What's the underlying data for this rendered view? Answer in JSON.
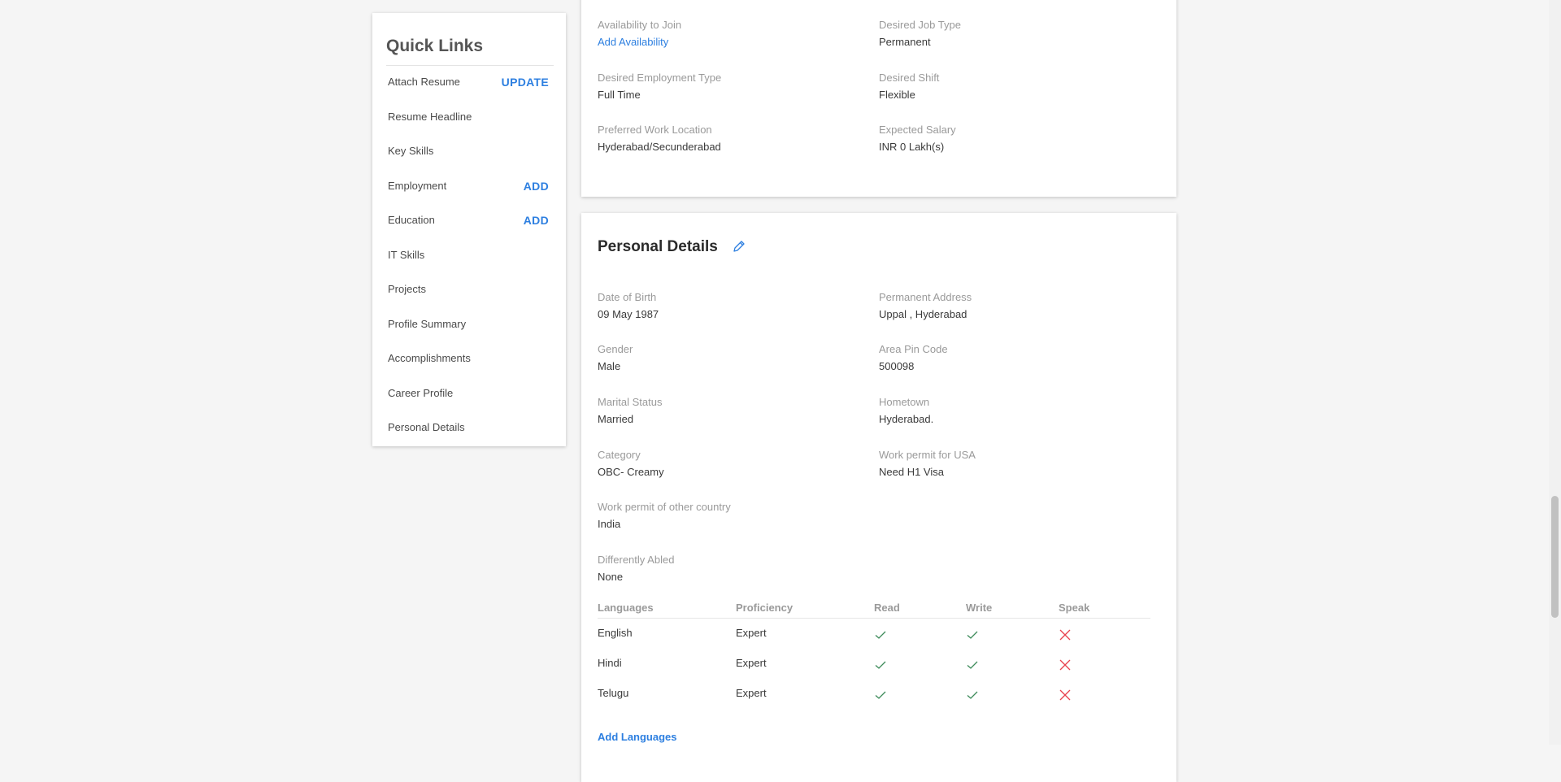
{
  "quick_links": {
    "title": "Quick Links",
    "items": [
      {
        "label": "Attach Resume",
        "action": "UPDATE"
      },
      {
        "label": "Resume Headline",
        "action": ""
      },
      {
        "label": "Key Skills",
        "action": ""
      },
      {
        "label": "Employment",
        "action": "ADD"
      },
      {
        "label": "Education",
        "action": "ADD"
      },
      {
        "label": "IT Skills",
        "action": ""
      },
      {
        "label": "Projects",
        "action": ""
      },
      {
        "label": "Profile Summary",
        "action": ""
      },
      {
        "label": "Accomplishments",
        "action": ""
      },
      {
        "label": "Career Profile",
        "action": ""
      },
      {
        "label": "Personal Details",
        "action": ""
      }
    ]
  },
  "career_profile": {
    "fields": [
      {
        "label": "Availability to Join",
        "value": "Add Availability",
        "is_link": true
      },
      {
        "label": "Desired Job Type",
        "value": "Permanent"
      },
      {
        "label": "Desired Employment Type",
        "value": "Full Time"
      },
      {
        "label": "Desired Shift",
        "value": "Flexible"
      },
      {
        "label": "Preferred Work Location",
        "value": "Hyderabad/Secunderabad"
      },
      {
        "label": "Expected Salary",
        "value": "INR 0 Lakh(s)"
      }
    ]
  },
  "personal_details": {
    "title": "Personal Details",
    "fields": [
      {
        "label": "Date of Birth",
        "value": "09 May 1987"
      },
      {
        "label": "Permanent Address",
        "value": "Uppal , Hyderabad"
      },
      {
        "label": "Gender",
        "value": "Male"
      },
      {
        "label": "Area Pin Code",
        "value": "500098"
      },
      {
        "label": "Marital Status",
        "value": "Married"
      },
      {
        "label": "Hometown",
        "value": "Hyderabad."
      },
      {
        "label": "Category",
        "value": "OBC- Creamy"
      },
      {
        "label": "Work permit for USA",
        "value": "Need H1 Visa"
      },
      {
        "label": "Work permit of other country",
        "value": "India"
      },
      {
        "label": "Differently Abled",
        "value": "None"
      }
    ],
    "languages": {
      "headers": [
        "Languages",
        "Proficiency",
        "Read",
        "Write",
        "Speak"
      ],
      "rows": [
        {
          "language": "English",
          "proficiency": "Expert",
          "read": true,
          "write": true,
          "speak": false
        },
        {
          "language": "Hindi",
          "proficiency": "Expert",
          "read": true,
          "write": true,
          "speak": false
        },
        {
          "language": "Telugu",
          "proficiency": "Expert",
          "read": true,
          "write": true,
          "speak": false
        }
      ],
      "add_label": "Add Languages"
    }
  },
  "colors": {
    "accent": "#2d7fe0",
    "check": "#3d8b5a",
    "cross": "#e8414d"
  }
}
